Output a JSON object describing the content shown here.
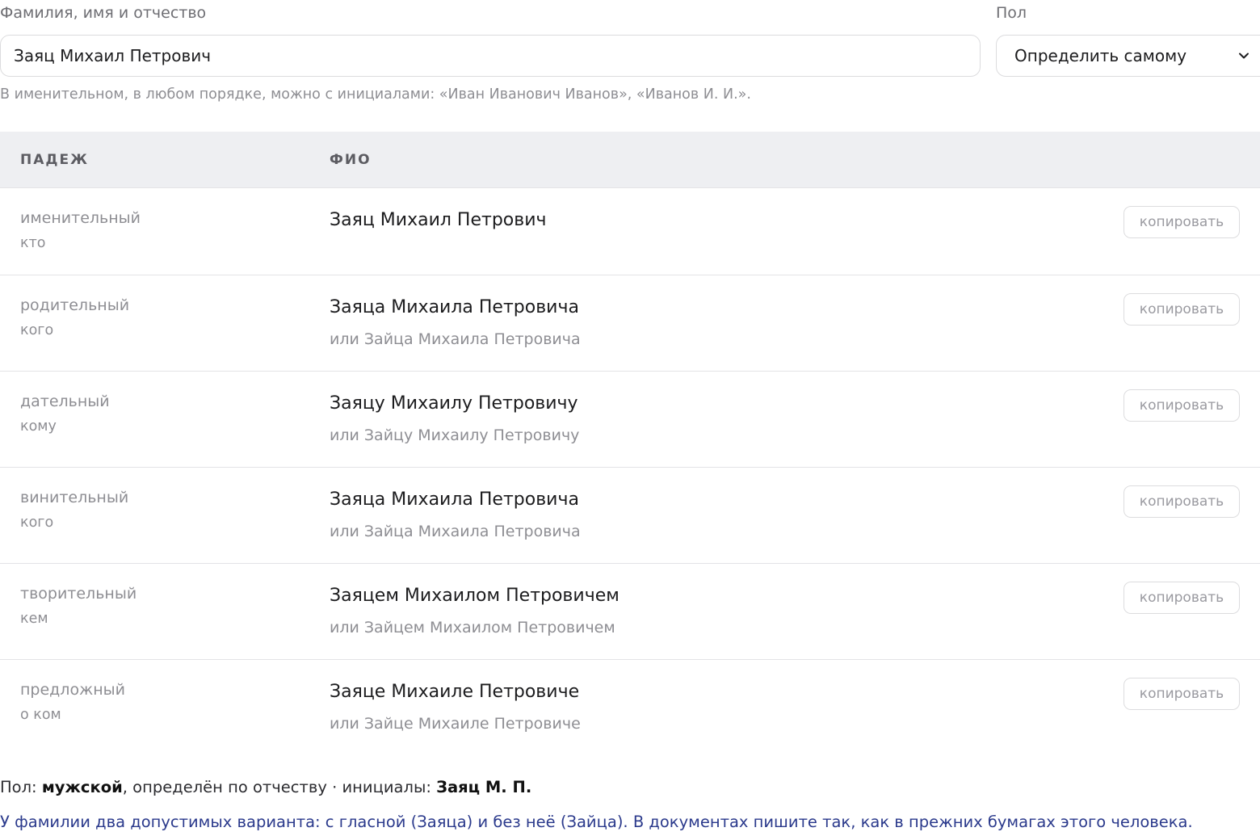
{
  "form": {
    "name_label": "Фамилия, имя и отчество",
    "name_value": "Заяц Михаил Петрович",
    "gender_label": "Пол",
    "gender_selected": "Определить самому",
    "hint": "В именительном, в любом порядке, можно с инициалами: «Иван Иванович Иванов», «Иванов И. И.»."
  },
  "table": {
    "col_case": "ПАДЕЖ",
    "col_fio": "ФИО",
    "copy_label": "копировать",
    "rows": [
      {
        "case": "именительный",
        "question": "кто",
        "main": "Заяц Михаил Петрович",
        "alt": ""
      },
      {
        "case": "родительный",
        "question": "кого",
        "main": "Заяца Михаила Петровича",
        "alt": "или Зайца Михаила Петровича"
      },
      {
        "case": "дательный",
        "question": "кому",
        "main": "Заяцу Михаилу Петровичу",
        "alt": "или Зайцу Михаилу Петровичу"
      },
      {
        "case": "винительный",
        "question": "кого",
        "main": "Заяца Михаила Петровича",
        "alt": "или Зайца Михаила Петровича"
      },
      {
        "case": "творительный",
        "question": "кем",
        "main": "Заяцем Михаилом Петровичем",
        "alt": "или Зайцем Михаилом Петровичем"
      },
      {
        "case": "предложный",
        "question": "о ком",
        "main": "Заяце Михаиле Петровиче",
        "alt": "или Зайце Михаиле Петровиче"
      }
    ]
  },
  "summary": {
    "gender_prefix": "Пол:",
    "gender_value": "мужской",
    "determined_text": ", определён по отчеству · инициалы:",
    "initials": "Заяц М. П."
  },
  "note": "У фамилии два допустимых варианта: с гласной (Заяца) и без неё (Зайца). В документах пишите так, как в прежних бумагах этого человека.",
  "colors": {
    "header_bg": "#eeeff2",
    "note_link": "#2b3a8c",
    "muted_text": "#8e8e93"
  },
  "icons": {
    "select_arrow": "chevron-down-icon"
  }
}
